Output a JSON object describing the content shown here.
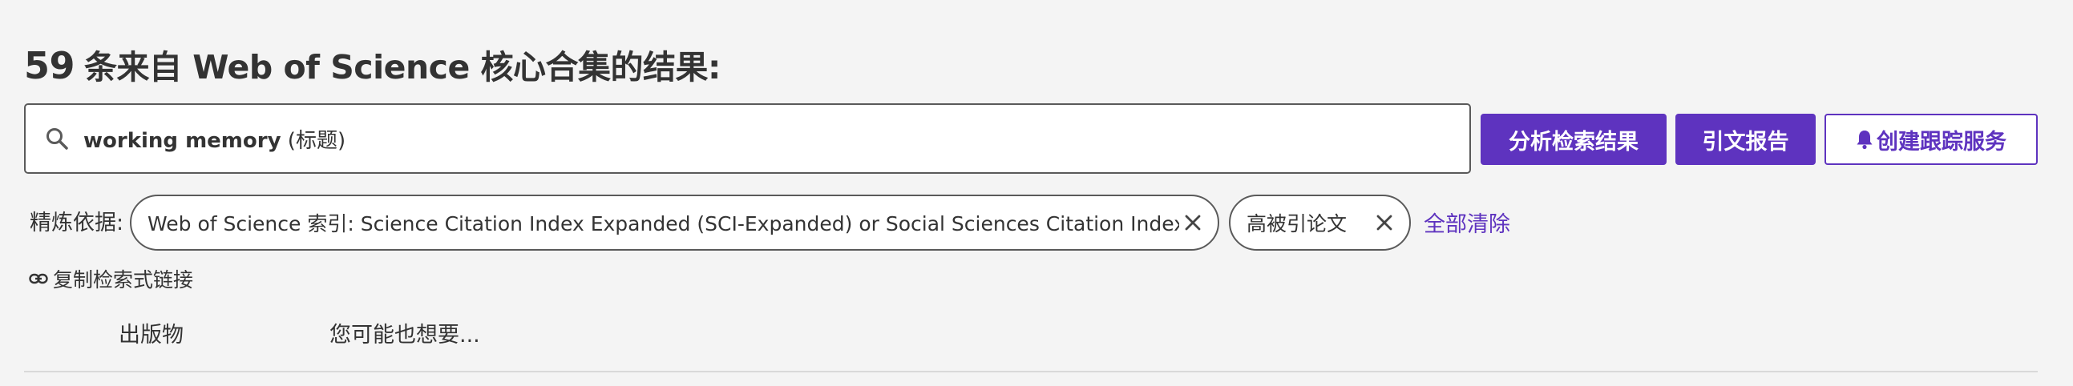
{
  "header": {
    "result_count": "59",
    "title_text": "条来自 Web of Science 核心合集的结果:"
  },
  "search": {
    "query": "working memory",
    "field": "(标题)",
    "icon": "search-icon"
  },
  "actions": {
    "analyze_label": "分析检索结果",
    "citation_report_label": "引文报告",
    "create_alert_label": "创建跟踪服务",
    "alert_icon": "bell-icon"
  },
  "refine": {
    "label": "精炼依据:",
    "chips": [
      {
        "label": "Web of Science 索引: Science Citation Index Expanded (SCI-Expanded) or Social Sciences Citation Index (SSCI)"
      },
      {
        "label": "高被引论文"
      }
    ],
    "clear_all_label": "全部清除"
  },
  "copy_link": {
    "label": "复制检索式链接",
    "icon": "link-icon"
  },
  "tabs": [
    {
      "label": "出版物"
    },
    {
      "label": "您可能也想要..."
    }
  ],
  "colors": {
    "accent": "#5e33bf",
    "text": "#333333",
    "background": "#f4f4f4"
  }
}
